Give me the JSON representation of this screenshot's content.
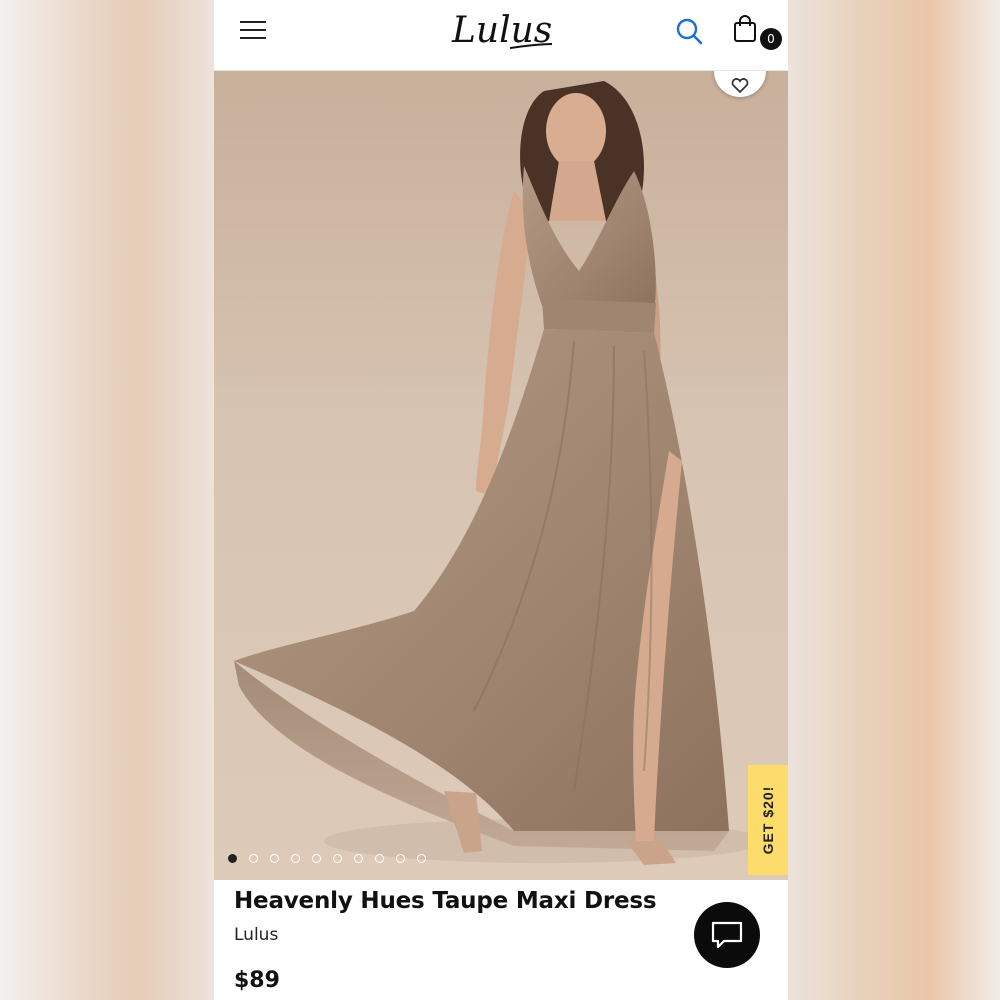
{
  "header": {
    "logo_text": "Lulus",
    "menu_icon": "hamburger-menu-icon",
    "search_icon": "search-icon",
    "cart_icon": "shopping-bag-icon",
    "cart_count": "0",
    "search_color": "#1f6fd1"
  },
  "product": {
    "title": "Heavenly Hues Taupe Maxi Dress",
    "brand": "Lulus",
    "price": "$89",
    "image_icon": "model-in-taupe-maxi-dress-photo",
    "favorite_icon": "favorite-heart-icon",
    "gallery": {
      "total_images": 10,
      "active_index": 0
    }
  },
  "promo": {
    "label": "GET $20!",
    "color": "#fddc6c"
  },
  "chat": {
    "icon": "chat-bubble-icon"
  }
}
